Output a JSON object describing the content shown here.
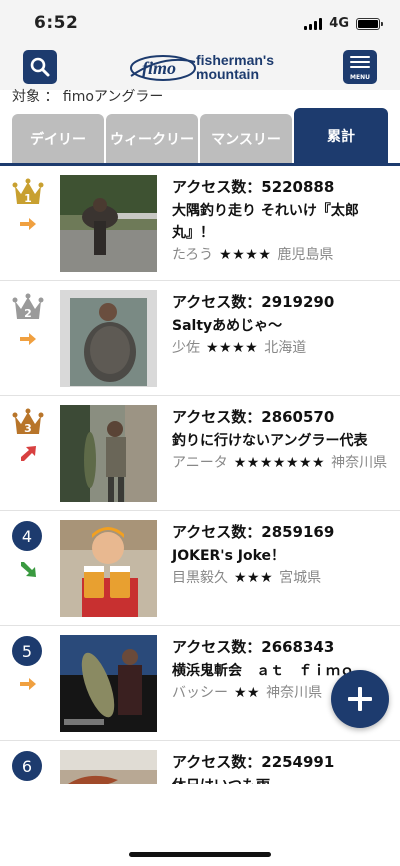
{
  "status": {
    "time": "6:52",
    "network": "4G"
  },
  "header": {
    "logo_text_line1": "fisherman's",
    "logo_text_line2": "mountain",
    "menu_label": "MENU",
    "logo_mark": "fimo"
  },
  "subject": "対象 ： fimoアングラー",
  "tabs": [
    {
      "label": "デイリー",
      "active": false
    },
    {
      "label": "ウィークリー",
      "active": false
    },
    {
      "label": "マンスリー",
      "active": false
    },
    {
      "label": "累計",
      "active": true
    }
  ],
  "rankings": [
    {
      "rank": "1",
      "rank_style": "gold-crown",
      "trend": "flat",
      "access": "アクセス数：5220888",
      "title": "大隅釣り走り それいけ『太郎丸』！",
      "user": "たろう",
      "stars": "★★★★",
      "location": "鹿児島県"
    },
    {
      "rank": "2",
      "rank_style": "silver-crown",
      "trend": "flat",
      "access": "アクセス数：2919290",
      "title": "Saltyあめじゃ〜",
      "user": "少佐",
      "stars": "★★★★",
      "location": "北海道"
    },
    {
      "rank": "3",
      "rank_style": "bronze-crown",
      "trend": "up",
      "access": "アクセス数：2860570",
      "title": "釣りに行けないアングラー代表",
      "user": "アニータ",
      "stars": "★★★★★★★",
      "location": "神奈川県"
    },
    {
      "rank": "4",
      "rank_style": "number",
      "trend": "down",
      "access": "アクセス数：2859169",
      "title": "JOKER's Joke！",
      "user": "目黒毅久",
      "stars": "★★★",
      "location": "宮城県"
    },
    {
      "rank": "5",
      "rank_style": "number",
      "trend": "flat",
      "access": "アクセス数：2668343",
      "title": "横浜鬼斬会　ａｔ　ｆｉｍｏ",
      "user": "バッシー",
      "stars": "★★",
      "location": "神奈川県"
    },
    {
      "rank": "6",
      "rank_style": "number",
      "trend": "flat",
      "access": "アクセス数：2254991",
      "title": "休日はいつも雨",
      "user": "",
      "stars": "",
      "location": ""
    }
  ],
  "colors": {
    "brand": "#1d3b6e",
    "tab_inactive": "#bdbdbd",
    "gold": "#c8a030",
    "silver": "#9a9a9a",
    "bronze": "#b8752a",
    "trend_flat": "#f0a040",
    "trend_up": "#d84040",
    "trend_down": "#3a9a40"
  }
}
